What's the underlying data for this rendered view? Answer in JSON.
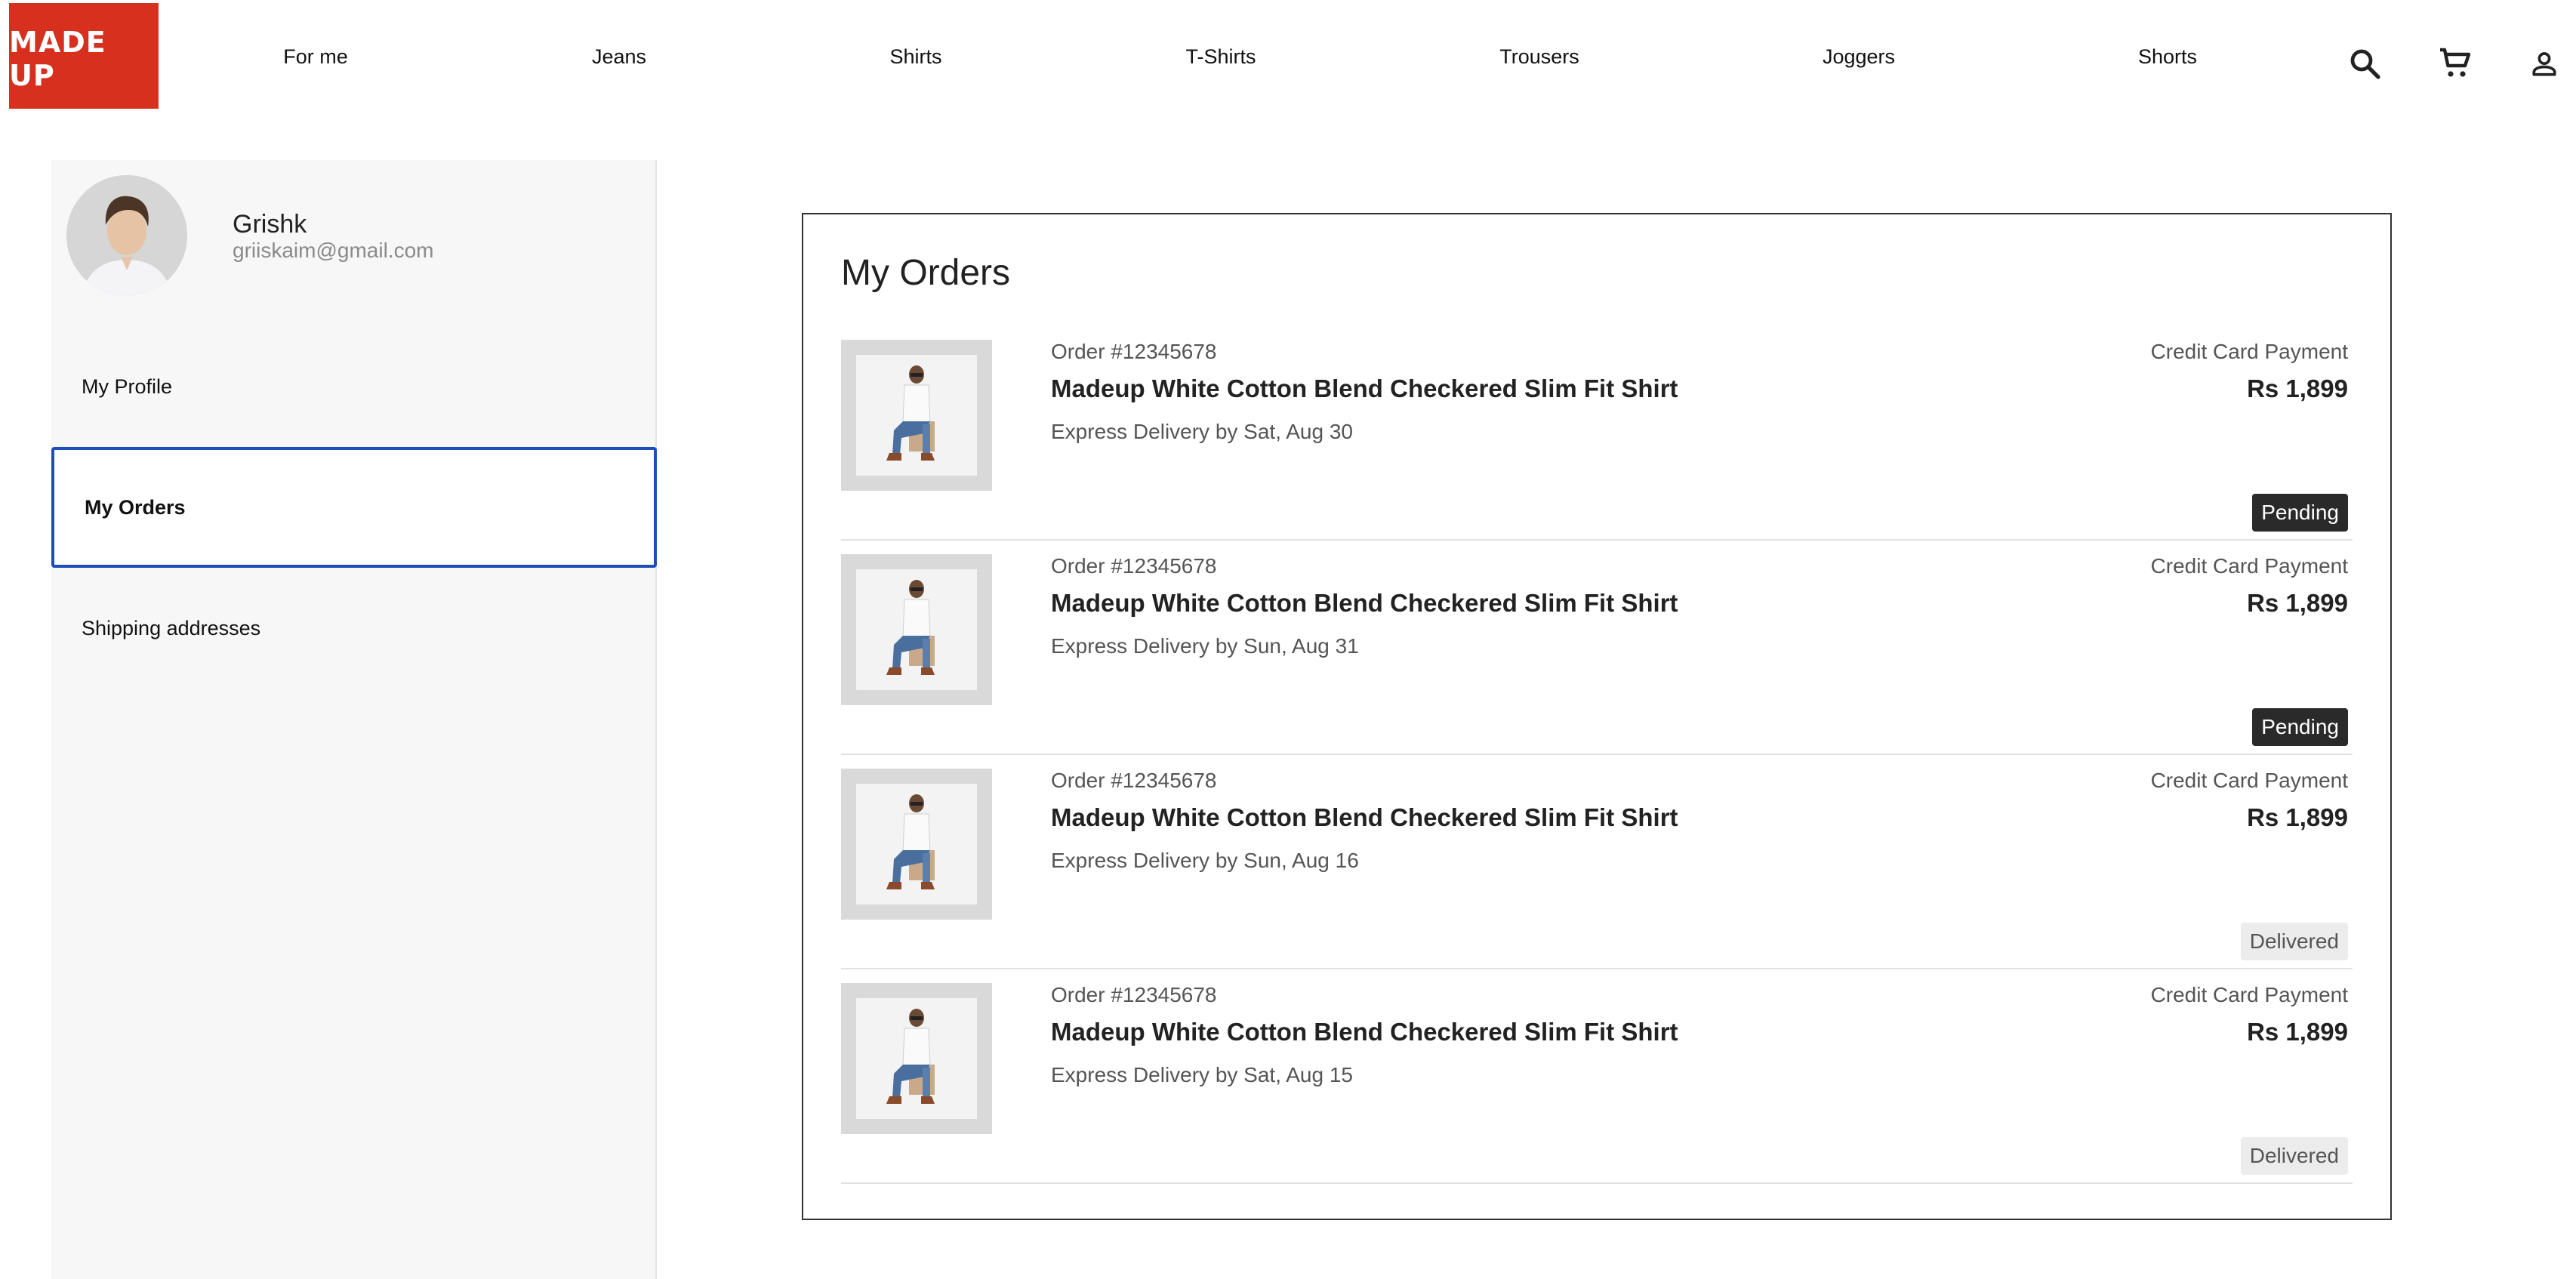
{
  "brand": {
    "logo_text": "MADE UP",
    "color": "#d7301f"
  },
  "nav": {
    "items": [
      {
        "label": "For me"
      },
      {
        "label": "Jeans"
      },
      {
        "label": "Shirts"
      },
      {
        "label": "T-Shirts"
      },
      {
        "label": "Trousers"
      },
      {
        "label": "Joggers"
      },
      {
        "label": "Shorts"
      }
    ],
    "icons": [
      "search-icon",
      "cart-icon",
      "user-icon"
    ]
  },
  "profile": {
    "name": "Grishk",
    "email": "griiskaim@gmail.com"
  },
  "sidebar": {
    "items": [
      {
        "label": "My Profile"
      },
      {
        "label": "My Orders",
        "active": true
      },
      {
        "label": "Shipping addresses"
      }
    ],
    "active_border_color": "#1d4fb8"
  },
  "orders": {
    "title": "My Orders",
    "list": [
      {
        "id": "Order #12345678",
        "title": "Madeup White Cotton Blend Checkered Slim Fit Shirt",
        "delivery": "Express Delivery by Sat, Aug 30",
        "payment": "Credit Card Payment",
        "price": "Rs 1,899",
        "status": "Pending"
      },
      {
        "id": "Order #12345678",
        "title": "Madeup White Cotton Blend Checkered Slim Fit Shirt",
        "delivery": "Express Delivery by Sun, Aug 31",
        "payment": "Credit Card Payment",
        "price": "Rs 1,899",
        "status": "Pending"
      },
      {
        "id": "Order #12345678",
        "title": "Madeup White Cotton Blend Checkered Slim Fit Shirt",
        "delivery": "Express Delivery by Sun, Aug 16",
        "payment": "Credit Card Payment",
        "price": "Rs 1,899",
        "status": "Delivered"
      },
      {
        "id": "Order #12345678",
        "title": "Madeup White Cotton Blend Checkered Slim Fit Shirt",
        "delivery": "Express Delivery by Sat, Aug 15",
        "payment": "Credit Card Payment",
        "price": "Rs 1,899",
        "status": "Delivered"
      }
    ]
  }
}
